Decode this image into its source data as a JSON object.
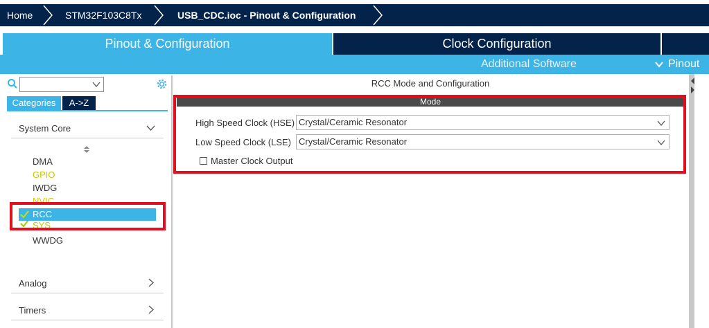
{
  "breadcrumb": {
    "home": "Home",
    "device": "STM32F103C8Tx",
    "file": "USB_CDC.ioc - Pinout & Configuration"
  },
  "tabs": {
    "pinout": "Pinout & Configuration",
    "clock": "Clock Configuration",
    "additional": "Additional Software",
    "pinout_view": "Pinout"
  },
  "left": {
    "search_value": "",
    "categories_tab": "Categories",
    "az_tab": "A->Z",
    "system_core": "System Core",
    "items": [
      "DMA",
      "GPIO",
      "IWDG",
      "NVIC",
      "RCC",
      "SYS",
      "WWDG"
    ],
    "analog": "Analog",
    "timers": "Timers"
  },
  "right": {
    "title": "RCC Mode and Configuration",
    "mode_header": "Mode",
    "hse_label": "High Speed Clock (HSE)",
    "hse_value": "Crystal/Ceramic Resonator",
    "lse_label": "Low Speed Clock (LSE)",
    "lse_value": "Crystal/Ceramic Resonator",
    "mco_label": "Master Clock Output"
  },
  "colors": {
    "navy": "#03234b",
    "blue": "#3cb4e6",
    "highlight_red": "#e0101e",
    "olive": "#c8c800",
    "check_green": "#a8c800"
  }
}
